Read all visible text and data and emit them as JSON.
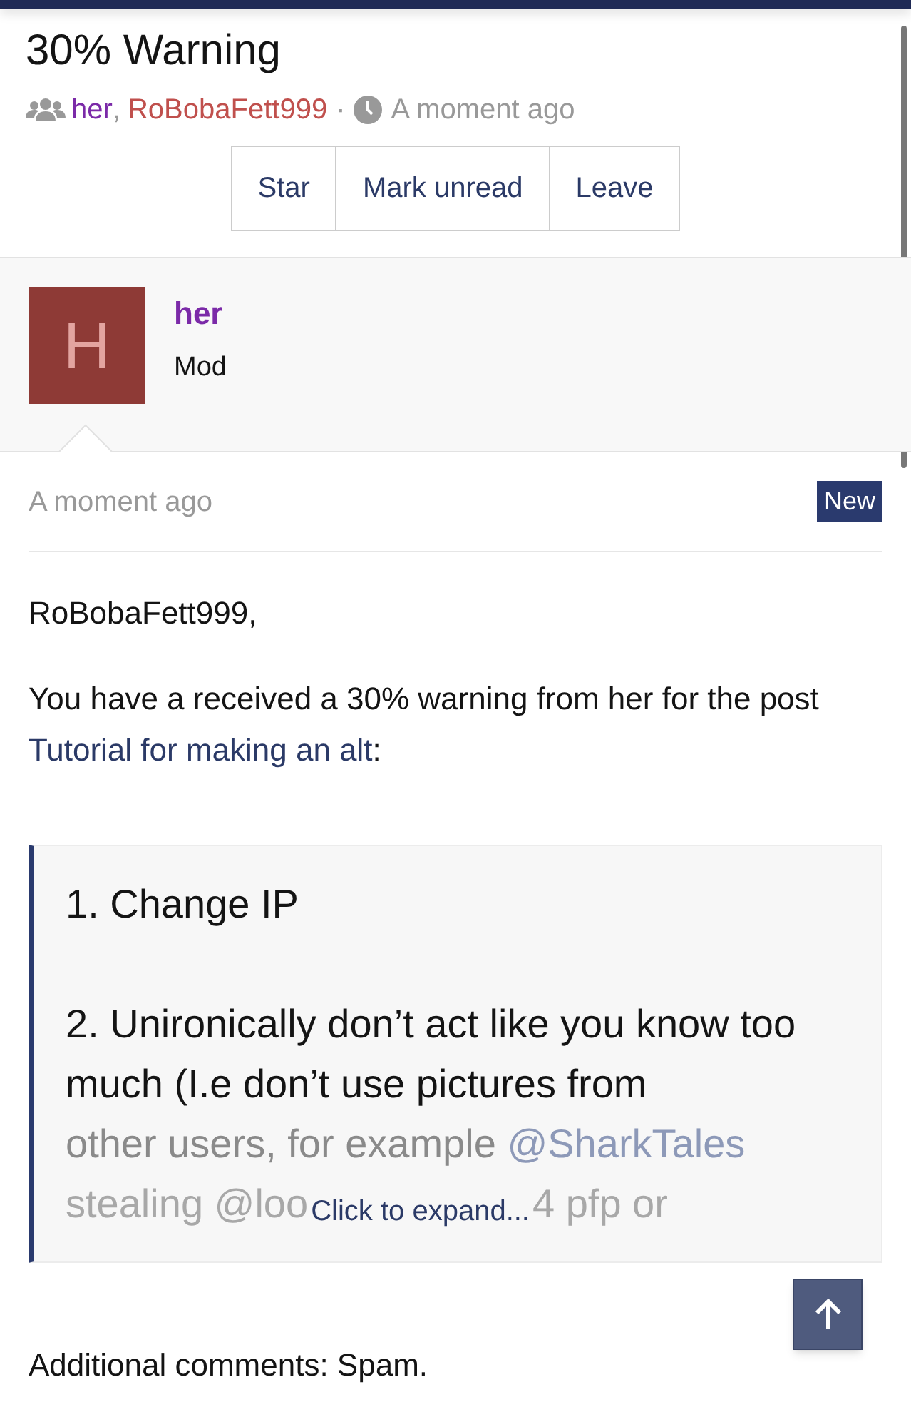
{
  "thread": {
    "title": "30% Warning",
    "participants": [
      {
        "name": "her",
        "color": "#7b2aa8"
      },
      {
        "name": "RoBobaFett999",
        "color": "#c0504d"
      }
    ],
    "separator": ",",
    "dot": "·",
    "time": "A moment ago"
  },
  "actions": [
    "Star",
    "Mark unread",
    "Leave"
  ],
  "author": {
    "initial": "H",
    "name": "her",
    "role": "Mod"
  },
  "message": {
    "time": "A moment ago",
    "badge": "New",
    "greeting": "RoBobaFett999,",
    "text_before": "You have a received a 30% warning from her for the post ",
    "link": "Tutorial for making an alt",
    "text_after": ":",
    "quote": {
      "lines": [
        "1. Change IP",
        "2. Unironically don’t act like you know too much (I.e don’t use pictures from"
      ],
      "faded_text": "other users, for example ",
      "faded_mention": "@SharkTales",
      "cut_start": "stealing @loo",
      "cut_end": "4 pfp or",
      "expand": "Click to expand..."
    },
    "comments": "Additional comments: Spam."
  }
}
